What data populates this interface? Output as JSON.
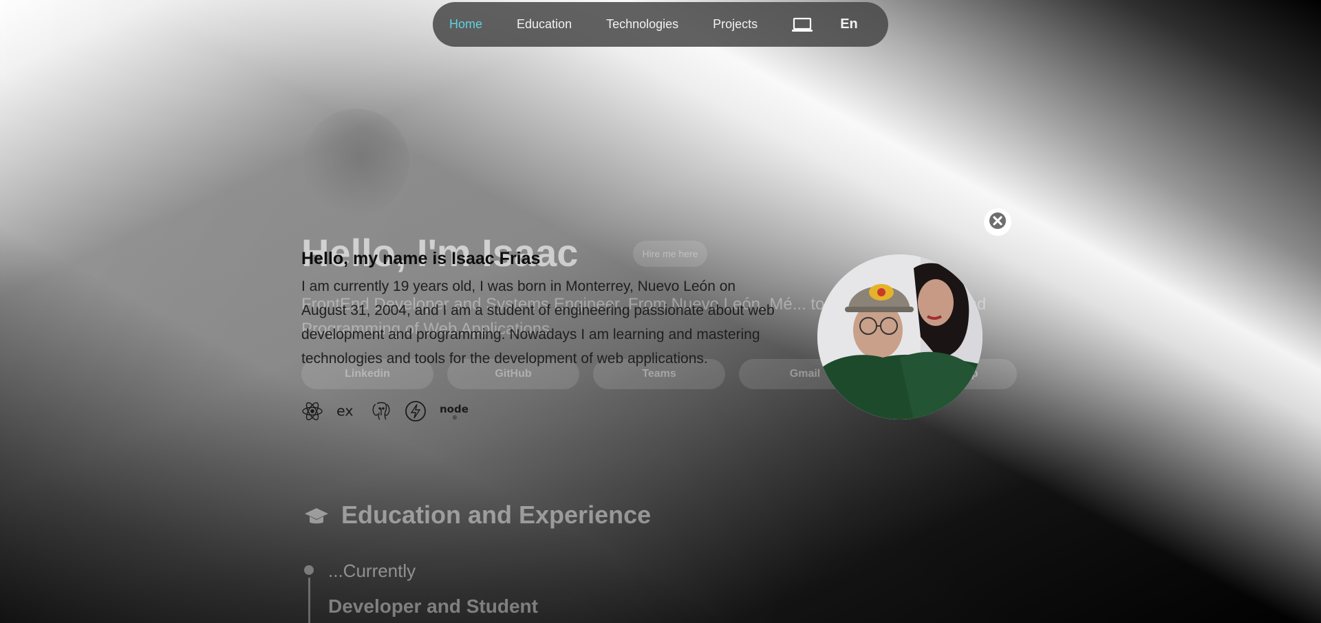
{
  "nav": {
    "items": [
      "Home",
      "Education",
      "Technologies",
      "Projects"
    ],
    "active": "Home",
    "laptop_icon": "laptop-icon",
    "lang": "En",
    "accent": "#5fd3e0"
  },
  "background_page": {
    "title": "Hello, I'm Isaac",
    "hire_label": "Hire me here",
    "subtitle": "FrontEnd Developer and Systems Engineer. From Nuevo León, Mé... to the Development and Programming of Web Applications.",
    "buttons": [
      "Linkedin",
      "GitHub",
      "Teams",
      "Gmail",
      "WhatsApp"
    ],
    "education_heading": "Education and Experience",
    "currently": "...Currently",
    "role": "Developer and Student"
  },
  "modal": {
    "heading": "Hello, my name is Isaac Frias",
    "body": "I am currently 19 years old, I was born in Monterrey, Nuevo León on August 31, 2004, and I am a student of engineering passionate about web development and programming. Nowadays I am learning and mastering technologies and tools for the development of web applications.",
    "tech_icons": [
      "react-icon",
      "express-icon",
      "postgresql-icon",
      "supabase-icon",
      "nodejs-icon"
    ],
    "close_icon": "close-icon"
  }
}
